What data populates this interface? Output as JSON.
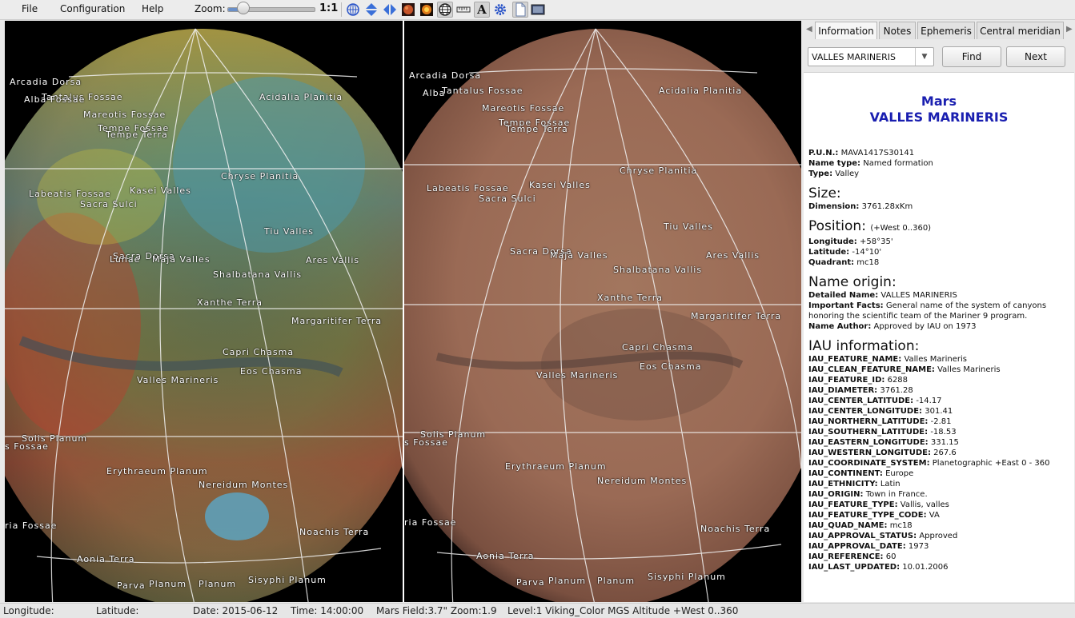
{
  "menu": {
    "file": "File",
    "configuration": "Configuration",
    "help": "Help"
  },
  "zoom": {
    "label": "Zoom:",
    "ratio": "1:1",
    "level": 0.2
  },
  "globes": {
    "left_labels": [
      "Arcadia Dorsa",
      "Tantalus Fossae",
      "Alba Fossae",
      "Mareotis Fossae",
      "Tempe Fossae",
      "Tempe Terra",
      "Acidalia Planitia",
      "Chryse Planitia",
      "Labeatis Fossae",
      "Kasei Valles",
      "Sacra Sulci",
      "Tiu Valles",
      "Sacra Dorsa",
      "Lunae",
      "Maja Valles",
      "Ares Vallis",
      "Shalbatana Vallis",
      "Xanthe Terra",
      "Margaritifer Terra",
      "Capri Chasma",
      "Eos Chasma",
      "Valles Marineris",
      "Solis Planum",
      "s Fossae",
      "Erythraeum Planum",
      "Nereidum Montes",
      "ria Fossae",
      "Noachis Terra",
      "Aonia Terra",
      "Sisyphi Planum",
      "Parva",
      "Planum",
      "Planum"
    ],
    "right_labels": [
      "Arcadia Dorsa",
      "Tantalus Fossae",
      "Alba",
      "Mareotis Fossae",
      "Tempe Fossae",
      "Tempe Terra",
      "Acidalia Planitia",
      "Chryse Planitia",
      "Labeatis Fossae",
      "Kasei Valles",
      "Sacra Sulci",
      "Tiu Valles",
      "Sacra Dorsa",
      "Maja Valles",
      "Ares Vallis",
      "Shalbatana Vallis",
      "Xanthe Terra",
      "Margaritifer Terra",
      "Capri Chasma",
      "Eos Chasma",
      "Valles Marineris",
      "Solis Planum",
      "s Fossae",
      "Erythraeum Planum",
      "Nereidum Montes",
      "ria Fossae",
      "Noachis Terra",
      "Aonia Terra",
      "Sisyphi Planum",
      "Parva",
      "Planum",
      "Planum"
    ]
  },
  "panel": {
    "tabs": [
      "Information",
      "Notes",
      "Ephemeris",
      "Central meridian"
    ],
    "combo_value": "VALLES MARINERIS",
    "find_label": "Find",
    "next_label": "Next",
    "title_planet": "Mars",
    "title_feature": "VALLES MARINERIS",
    "pun_label": "P.U.N.:",
    "pun_value": "MAVA1417S30141",
    "name_type_label": "Name type:",
    "name_type_value": "Named formation",
    "type_label": "Type:",
    "type_value": "Valley",
    "size_header": "Size:",
    "dimension_label": "Dimension:",
    "dimension_value": "3761.28xKm",
    "position_header": "Position:",
    "position_note": "(+West 0..360)",
    "longitude_label": "Longitude:",
    "longitude_value": "+58°35'",
    "latitude_label": "Latitude:",
    "latitude_value": "-14°10'",
    "quadrant_label": "Quadrant:",
    "quadrant_value": "mc18",
    "origin_header": "Name origin:",
    "detailed_label": "Detailed Name:",
    "detailed_value": "VALLES MARINERIS",
    "facts_label": "Important Facts:",
    "facts_value_1": "General name of the system of canyons",
    "facts_value_2": "honoring the scientific team of the Mariner 9 program.",
    "author_label": "Name Author:",
    "author_value": "Approved by IAU on 1973",
    "iau_header": "IAU information:",
    "iau": [
      {
        "k": "IAU_FEATURE_NAME:",
        "v": "Valles Marineris"
      },
      {
        "k": "IAU_CLEAN_FEATURE_NAME:",
        "v": "Valles Marineris"
      },
      {
        "k": "IAU_FEATURE_ID:",
        "v": "6288"
      },
      {
        "k": "IAU_DIAMETER:",
        "v": "3761.28"
      },
      {
        "k": "IAU_CENTER_LATITUDE:",
        "v": "-14.17"
      },
      {
        "k": "IAU_CENTER_LONGITUDE:",
        "v": "301.41"
      },
      {
        "k": "IAU_NORTHERN_LATITUDE:",
        "v": "-2.81"
      },
      {
        "k": "IAU_SOUTHERN_LATITUDE:",
        "v": "-18.53"
      },
      {
        "k": "IAU_EASTERN_LONGITUDE:",
        "v": "331.15"
      },
      {
        "k": "IAU_WESTERN_LONGITUDE:",
        "v": "267.6"
      },
      {
        "k": "IAU_COORDINATE_SYSTEM:",
        "v": "Planetographic +East 0 - 360"
      },
      {
        "k": "IAU_CONTINENT:",
        "v": "Europe"
      },
      {
        "k": "IAU_ETHNICITY:",
        "v": "Latin"
      },
      {
        "k": "IAU_ORIGIN:",
        "v": "Town in France."
      },
      {
        "k": "IAU_FEATURE_TYPE:",
        "v": "Vallis, valles"
      },
      {
        "k": "IAU_FEATURE_TYPE_CODE:",
        "v": "VA"
      },
      {
        "k": "IAU_QUAD_NAME:",
        "v": "mc18"
      },
      {
        "k": "IAU_APPROVAL_STATUS:",
        "v": "Approved"
      },
      {
        "k": "IAU_APPROVAL_DATE:",
        "v": "1973"
      },
      {
        "k": "IAU_REFERENCE:",
        "v": "60"
      },
      {
        "k": "IAU_LAST_UPDATED:",
        "v": "10.01.2006"
      }
    ]
  },
  "status": {
    "longitude": "Longitude:",
    "latitude": "Latitude:",
    "date": "Date: 2015-06-12",
    "time": "Time: 14:00:00",
    "field": "Mars Field:3.7\" Zoom:1.9",
    "level": "Level:1 Viking_Color MGS Altitude +West 0..360"
  },
  "icons": [
    "globe-grid-icon",
    "flip-vertical-icon",
    "flip-horizontal-icon",
    "mars-texture-icon",
    "sun-texture-icon",
    "globe-icon",
    "ruler-icon",
    "text-icon",
    "gear-icon",
    "page-icon",
    "screenshot-icon"
  ],
  "colors": {
    "title": "#1a1fb0",
    "accent": "#4a6fb8"
  }
}
